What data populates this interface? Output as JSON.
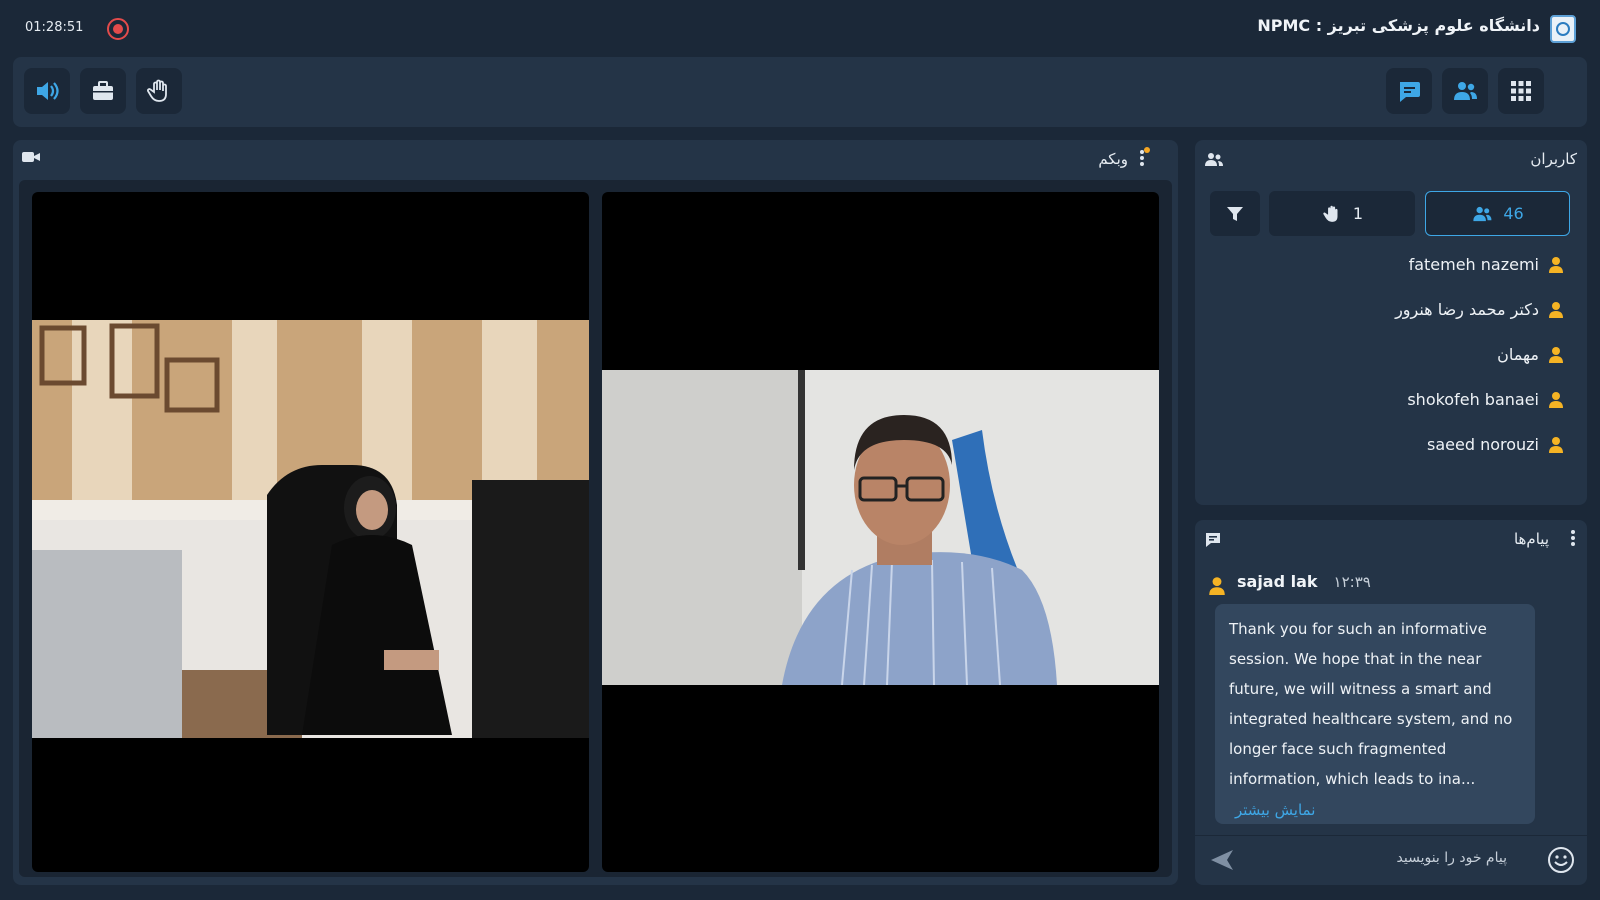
{
  "topbar": {
    "clock": "01:28:51",
    "title": "دانشگاه علوم پزشکی تبریز : NPMC"
  },
  "toolbar": {
    "left_icons": [
      "speaker-icon",
      "briefcase-icon",
      "hand-raise-icon"
    ],
    "right_icons": [
      "chat-icon",
      "users-icon",
      "grid-icon"
    ],
    "accent": "#3ea7e6"
  },
  "webcam": {
    "title": "وبکم"
  },
  "users": {
    "title": "کاربران",
    "count": "46",
    "raised_hands": "1",
    "list": [
      {
        "name": "fatemeh nazemi"
      },
      {
        "name": "دکتر محمد رضا هنرور"
      },
      {
        "name": "مهمان"
      },
      {
        "name": "shokofeh banaei"
      },
      {
        "name": "saeed norouzi"
      }
    ]
  },
  "messages": {
    "title": "پیام‌ها",
    "items": [
      {
        "user": "sajad lak",
        "time": "۱۲:۳۹",
        "text": "Thank you for such an informative session. We hope that in the near future, we will witness a smart and integrated healthcare system, and no longer face such fragmented information, which leads to ina...",
        "more": "نمایش بیشتر"
      }
    ],
    "input_placeholder": "پیام خود را بنویسید"
  }
}
